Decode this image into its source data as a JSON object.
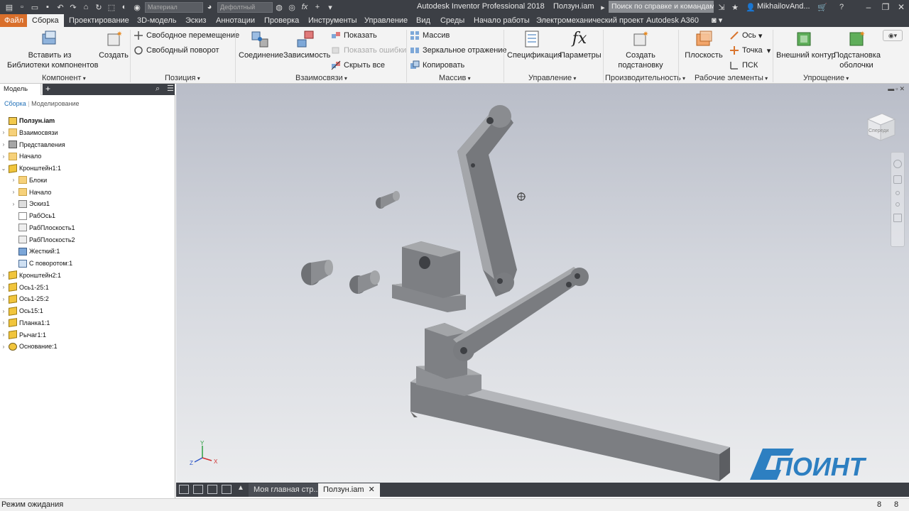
{
  "titlebar": {
    "title": "Autodesk Inventor Professional 2018",
    "document": "Ползун.iam",
    "material_combo": "Материал",
    "appearance_combo": "Дефолтный",
    "fx_icon": "fx-icon",
    "search_placeholder": "Поиск по справке и командам",
    "user": "MikhailovAnd...",
    "help": "?"
  },
  "tabs": {
    "file": "Файл",
    "items": [
      "Сборка",
      "Проектирование",
      "3D-модель",
      "Эскиз",
      "Аннотации",
      "Проверка",
      "Инструменты",
      "Управление",
      "Вид",
      "Среды",
      "Начало работы",
      "Электромеханический проект",
      "Autodesk A360"
    ]
  },
  "ribbon": {
    "component": {
      "label": "Компонент",
      "place_line1": "Вставить из",
      "place_line2": "Библиотеки компонентов",
      "create": "Создать"
    },
    "position": {
      "label": "Позиция",
      "free_move": "Свободное перемещение",
      "free_rotate": "Свободный поворот"
    },
    "relationships": {
      "label": "Взаимосвязи",
      "joint": "Соединение",
      "constrain": "Зависимость",
      "show": "Показать",
      "show_sick": "Показать ошибки",
      "hide_all": "Скрыть все"
    },
    "pattern": {
      "label": "Массив",
      "pattern": "Массив",
      "mirror": "Зеркальное отражение",
      "copy": "Копировать"
    },
    "manage": {
      "label": "Управление",
      "bom": "Спецификация",
      "parameters": "Параметры"
    },
    "productivity": {
      "label": "Производительность",
      "create_line1": "Создать",
      "create_line2": "подстановку"
    },
    "work_features": {
      "label": "Рабочие элементы",
      "plane": "Плоскость",
      "axis": "Ось",
      "point": "Точка",
      "ucs": "ПСК"
    },
    "simplification": {
      "label": "Упрощение",
      "shrinkwrap": "Внешний контур",
      "substitute_line1": "Подстановка",
      "substitute_line2": "оболочки"
    }
  },
  "browser": {
    "tab_model": "Модель",
    "add": "+",
    "subtab_assembly": "Сборка",
    "subtab_modeling": "Моделирование",
    "tree": [
      {
        "label": "Ползун.iam",
        "icon": "assembly-icon",
        "level": 0,
        "expander": "none",
        "bold": true
      },
      {
        "label": "Взаимосвязи",
        "icon": "folder-icon",
        "level": 0,
        "expander": "collapsed"
      },
      {
        "label": "Представления",
        "icon": "representations-icon",
        "level": 0,
        "expander": "collapsed"
      },
      {
        "label": "Начало",
        "icon": "folder-icon",
        "level": 0,
        "expander": "collapsed"
      },
      {
        "label": "Кронштейн1:1",
        "icon": "part-icon",
        "level": 0,
        "expander": "expanded"
      },
      {
        "label": "Блоки",
        "icon": "folder-icon",
        "level": 1,
        "expander": "collapsed"
      },
      {
        "label": "Начало",
        "icon": "folder-icon",
        "level": 1,
        "expander": "collapsed"
      },
      {
        "label": "Эскиз1",
        "icon": "sketch-icon",
        "level": 1,
        "expander": "collapsed"
      },
      {
        "label": "РабОсь1",
        "icon": "work-axis-icon",
        "level": 1,
        "expander": "none"
      },
      {
        "label": "РабПлоскость1",
        "icon": "work-plane-icon",
        "level": 1,
        "expander": "none"
      },
      {
        "label": "РабПлоскость2",
        "icon": "work-plane-icon",
        "level": 1,
        "expander": "none"
      },
      {
        "label": "Жесткий:1",
        "icon": "rigid-joint-icon",
        "level": 1,
        "expander": "none"
      },
      {
        "label": "С поворотом:1",
        "icon": "rotational-joint-icon",
        "level": 1,
        "expander": "none"
      },
      {
        "label": "Кронштейн2:1",
        "icon": "part-icon",
        "level": 0,
        "expander": "collapsed"
      },
      {
        "label": "Ось1-25:1",
        "icon": "part-icon",
        "level": 0,
        "expander": "collapsed"
      },
      {
        "label": "Ось1-25:2",
        "icon": "part-icon",
        "level": 0,
        "expander": "collapsed"
      },
      {
        "label": "Ось15:1",
        "icon": "part-icon",
        "level": 0,
        "expander": "collapsed"
      },
      {
        "label": "Планка1:1",
        "icon": "part-icon",
        "level": 0,
        "expander": "collapsed"
      },
      {
        "label": "Рычаг1:1",
        "icon": "part-icon",
        "level": 0,
        "expander": "collapsed"
      },
      {
        "label": "Основание:1",
        "icon": "grounded-part-icon",
        "level": 0,
        "expander": "collapsed"
      }
    ]
  },
  "viewport": {
    "viewcube_label": "Спереди",
    "logo_text": "ПОИНТ",
    "triad": {
      "x": "X",
      "y": "Y",
      "z": "Z"
    }
  },
  "doc_tabs": {
    "home": "Моя главная стр...",
    "active": "Ползун.iam",
    "close": "✕"
  },
  "status": {
    "text": "Режим ожидания",
    "n1": "8",
    "n2": "8"
  },
  "colors": {
    "file_tab": "#d96f2b",
    "title_bg": "#3c3f45",
    "ribbon_bg": "#f3f3f3",
    "part_gray": "#8a8c90",
    "logo_blue": "#2d7fc1"
  }
}
